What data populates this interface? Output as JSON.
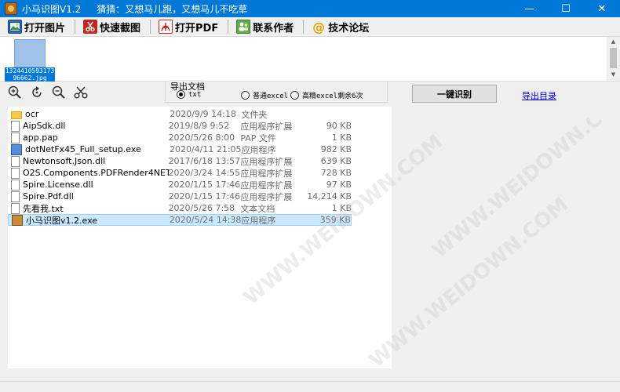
{
  "window": {
    "title": "小马识图V1.2",
    "subtitle": "猜猜：又想马儿跑，又想马儿不吃草",
    "controls": [
      "—",
      "☐",
      "✕"
    ]
  },
  "toolbar": {
    "items": [
      {
        "label": "打开图片",
        "icon": "open-image-icon"
      },
      {
        "label": "快速截图",
        "icon": "scissors-icon"
      },
      {
        "label": "打开PDF",
        "icon": "pdf-icon"
      },
      {
        "label": "联系作者",
        "icon": "contact-icon"
      },
      {
        "label": "技术论坛",
        "icon": "at-icon"
      }
    ]
  },
  "thumbnails": [
    {
      "filename": "132441059317396662.jpg"
    }
  ],
  "tools": [
    "zoom-in-icon",
    "rotate-icon",
    "zoom-out-icon",
    "cut-icon"
  ],
  "export": {
    "legend": "导出文档",
    "options": [
      {
        "label": "txt",
        "selected": true
      },
      {
        "label": "普通excel",
        "selected": false
      },
      {
        "label": "高精excel剩余6次",
        "selected": false
      }
    ]
  },
  "actions": {
    "recognize_label": "一键识别",
    "export_dir_label": "导出目录"
  },
  "files": [
    {
      "name": "ocr",
      "date": "2020/9/9 14:18",
      "type": "文件夹",
      "size": "",
      "icon": "folder"
    },
    {
      "name": "AipSdk.dll",
      "date": "2019/8/9 9:52",
      "type": "应用程序扩展",
      "size": "90 KB",
      "icon": "file"
    },
    {
      "name": "app.pap",
      "date": "2020/5/26 8:00",
      "type": "PAP 文件",
      "size": "1 KB",
      "icon": "file"
    },
    {
      "name": "dotNetFx45_Full_setup.exe",
      "date": "2020/4/11 21:05",
      "type": "应用程序",
      "size": "982 KB",
      "icon": "exe"
    },
    {
      "name": "Newtonsoft.Json.dll",
      "date": "2017/6/18 13:57",
      "type": "应用程序扩展",
      "size": "639 KB",
      "icon": "file"
    },
    {
      "name": "O2S.Components.PDFRender4NET.dll",
      "date": "2020/3/24 14:55",
      "type": "应用程序扩展",
      "size": "728 KB",
      "icon": "file"
    },
    {
      "name": "Spire.License.dll",
      "date": "2020/1/15 17:46",
      "type": "应用程序扩展",
      "size": "97 KB",
      "icon": "file"
    },
    {
      "name": "Spire.Pdf.dll",
      "date": "2020/1/15 17:46",
      "type": "应用程序扩展",
      "size": "14,214 KB",
      "icon": "file"
    },
    {
      "name": "先看我.txt",
      "date": "2020/5/26 7:58",
      "type": "文本文档",
      "size": "1 KB",
      "icon": "file"
    },
    {
      "name": "小马识图v1.2.exe",
      "date": "2020/5/24 14:38",
      "type": "应用程序",
      "size": "359 KB",
      "icon": "app",
      "selected": true
    }
  ],
  "watermark": "WWW.WEIDOWN.COM",
  "colors": {
    "titlebar": "#0078d7",
    "selection": "#cce8ff",
    "link": "#0000ee"
  }
}
